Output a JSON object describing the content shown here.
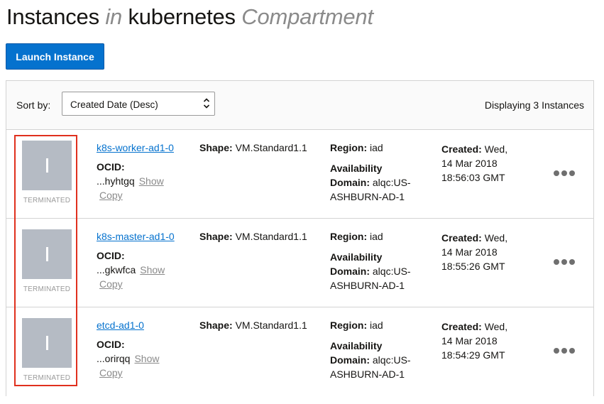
{
  "header": {
    "title_main": "Instances",
    "title_in": "in",
    "compartment": "kubernetes",
    "title_suffix": "Compartment"
  },
  "toolbar": {
    "launch_label": "Launch Instance"
  },
  "sort": {
    "label": "Sort by:",
    "selected": "Created Date (Desc)",
    "count_text": "Displaying 3 Instances"
  },
  "labels": {
    "ocid": "OCID:",
    "show": "Show",
    "copy": "Copy",
    "shape": "Shape:",
    "region": "Region:",
    "availability": "Availability",
    "domain": "Domain:",
    "created": "Created:"
  },
  "colors": {
    "accent": "#0572ce",
    "state_tile": "#b5bbc4",
    "highlight": "#e0301e"
  },
  "instances": [
    {
      "name": "k8s-worker-ad1-0",
      "state": "TERMINATED",
      "state_glyph": "I",
      "ocid": "...hyhtgq",
      "shape": "VM.Standard1.1",
      "region": "iad",
      "availability_domain": "alqc:US-ASHBURN-AD-1",
      "created_day": "Wed,",
      "created_date": "14 Mar 2018",
      "created_time": "18:56:03 GMT"
    },
    {
      "name": "k8s-master-ad1-0",
      "state": "TERMINATED",
      "state_glyph": "I",
      "ocid": "...gkwfca",
      "shape": "VM.Standard1.1",
      "region": "iad",
      "availability_domain": "alqc:US-ASHBURN-AD-1",
      "created_day": "Wed,",
      "created_date": "14 Mar 2018",
      "created_time": "18:55:26 GMT"
    },
    {
      "name": "etcd-ad1-0",
      "state": "TERMINATED",
      "state_glyph": "I",
      "ocid": "...orirqq",
      "shape": "VM.Standard1.1",
      "region": "iad",
      "availability_domain": "alqc:US-ASHBURN-AD-1",
      "created_day": "Wed,",
      "created_date": "14 Mar 2018",
      "created_time": "18:54:29 GMT"
    }
  ]
}
